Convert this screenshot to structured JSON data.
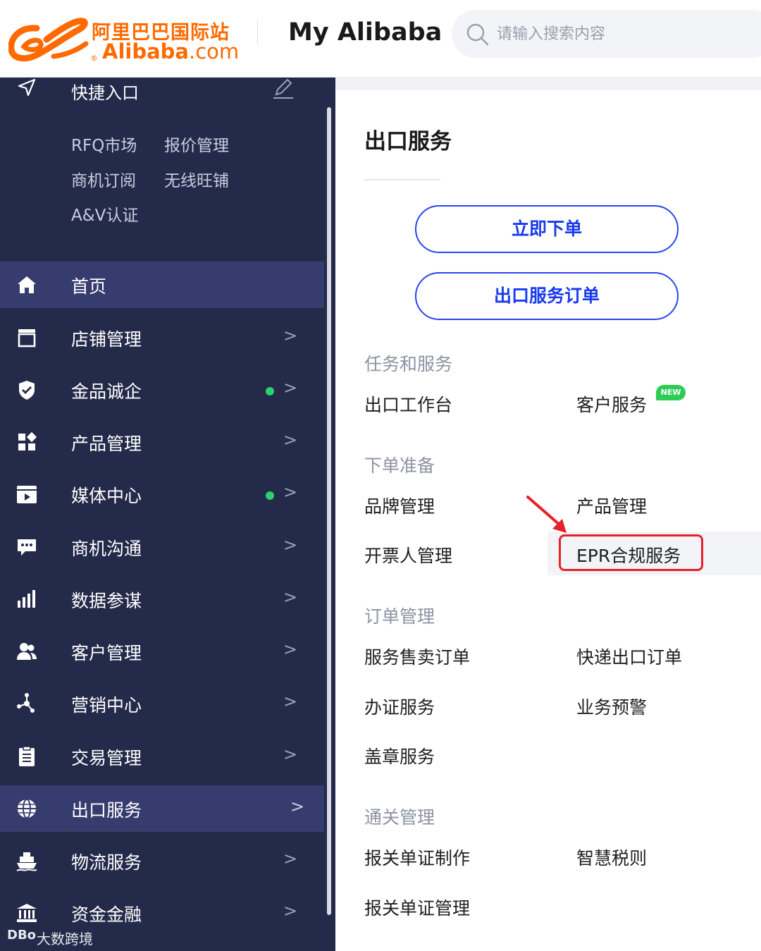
{
  "header": {
    "logo_cn": "阿里巴巴国际站",
    "logo_en": "Alibaba",
    "logo_en_suffix": ".com",
    "logo_reg": "®",
    "title": "My Alibaba",
    "search_placeholder": "请输入搜索内容",
    "brand_color": "#ff6a00"
  },
  "sidebar": {
    "background": "#242a4a",
    "quick_entry": {
      "title": "快捷入口",
      "links": [
        "RFQ市场",
        "报价管理",
        "商机订阅",
        "无线旺铺",
        "A&V认证"
      ]
    },
    "items": [
      {
        "label": "首页",
        "icon": "home-icon",
        "active": true,
        "arrow": "",
        "dot": false
      },
      {
        "label": "店铺管理",
        "icon": "store-icon",
        "active": false,
        "arrow": ">",
        "dot": false
      },
      {
        "label": "金品诚企",
        "icon": "shield-check-icon",
        "active": false,
        "arrow": ">",
        "dot": true
      },
      {
        "label": "产品管理",
        "icon": "grid-icon",
        "active": false,
        "arrow": ">",
        "dot": false
      },
      {
        "label": "媒体中心",
        "icon": "video-icon",
        "active": false,
        "arrow": ">",
        "dot": true
      },
      {
        "label": "商机沟通",
        "icon": "chat-icon",
        "active": false,
        "arrow": ">",
        "dot": false
      },
      {
        "label": "数据参谋",
        "icon": "bar-chart-icon",
        "active": false,
        "arrow": ">",
        "dot": false
      },
      {
        "label": "客户管理",
        "icon": "users-icon",
        "active": false,
        "arrow": ">",
        "dot": false
      },
      {
        "label": "营销中心",
        "icon": "network-icon",
        "active": false,
        "arrow": ">",
        "dot": false
      },
      {
        "label": "交易管理",
        "icon": "clipboard-icon",
        "active": false,
        "arrow": ">",
        "dot": false
      },
      {
        "label": "出口服务",
        "icon": "globe-icon",
        "active": true,
        "arrow": ">",
        "dot": false
      },
      {
        "label": "物流服务",
        "icon": "ship-icon",
        "active": false,
        "arrow": ">",
        "dot": false
      },
      {
        "label": "资金金融",
        "icon": "bank-icon",
        "active": false,
        "arrow": ">",
        "dot": false
      }
    ]
  },
  "panel": {
    "title": "出口服务",
    "buttons": [
      "立即下单",
      "出口服务订单"
    ],
    "accent_color": "#2a43f0",
    "sections": [
      {
        "heading": "任务和服务",
        "links": [
          "出口工作台",
          "客户服务"
        ]
      },
      {
        "heading": "下单准备",
        "links": [
          "品牌管理",
          "产品管理",
          "开票人管理",
          "EPR合规服务"
        ]
      },
      {
        "heading": "订单管理",
        "links": [
          "服务售卖订单",
          "快递出口订单",
          "办证服务",
          "业务预警",
          "盖章服务"
        ]
      },
      {
        "heading": "通关管理",
        "links": [
          "报关单证制作",
          "智慧税则",
          "报关单证管理"
        ]
      }
    ],
    "new_badge": "NEW",
    "highlight_color": "#e8202a"
  },
  "watermark": {
    "logo": "DBo",
    "text": "大数跨境"
  }
}
